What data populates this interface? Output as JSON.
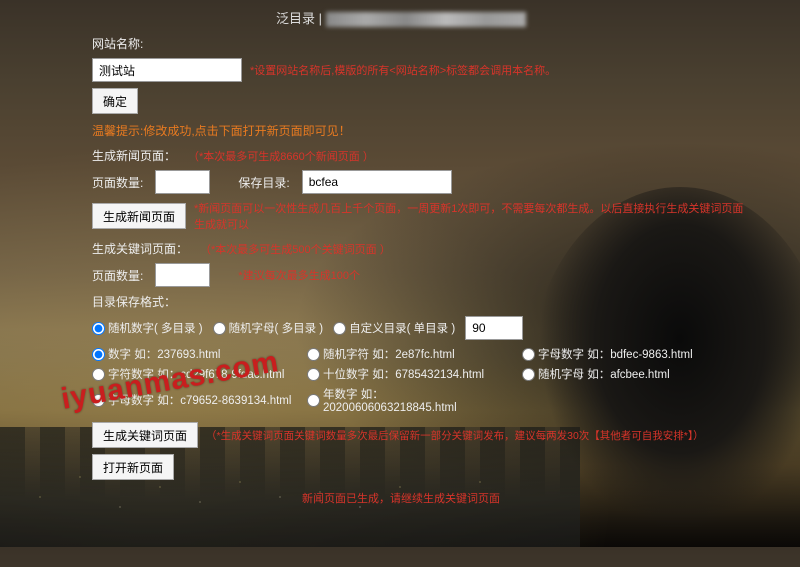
{
  "title_prefix": "泛目录 |",
  "watermark": "iyuanmas.com",
  "site": {
    "name_label": "网站名称:",
    "name_value": "测试站",
    "name_hint": "*设置网站名称后,模版的所有<网站名称>标签都会调用本名称。",
    "confirm_btn": "确定"
  },
  "tip_line": "温馨提示:修改成功,点击下面打开新页面即可见！",
  "news": {
    "gen_label": "生成新闻页面：",
    "gen_hint": "（*本次最多可生成8660个新闻页面 ）",
    "count_label": "页面数量:",
    "count_value": "",
    "save_dir_label": "保存目录:",
    "save_dir_value": "bcfea",
    "gen_btn": "生成新闻页面",
    "gen_note": "*新闻页面可以一次性生成几百上千个页面，一周更新1次即可，不需要每次都生成。以后直接执行生成关键词页面生成就可以"
  },
  "keyword": {
    "gen_label": "生成关键词页面：",
    "gen_hint": "（*本次最多可生成500个关键词页面 ）",
    "count_label": "页面数量:",
    "count_value": "",
    "count_hint": "*建议每次最多生成100个",
    "dir_format_label": "目录保存格式：",
    "dir_opts": {
      "opt1": "随机数字( 多目录 )",
      "opt2": "随机字母( 多目录 )",
      "opt3": "自定义目录( 单目录 )",
      "custom_value": "90"
    },
    "fmt_opts": {
      "r1c1": "数字 如：237693.html",
      "r1c2": "随机字符 如：2e87fc.html",
      "r1c3": "字母数字 如：bdfec-9863.html",
      "r2c1": "字符数字 如：cd29f678-9fdac.html",
      "r2c2": "十位数字 如：6785432134.html",
      "r2c3": "随机字母 如：afcbee.html",
      "r3c1": "字母数字 如：c79652-8639134.html",
      "r3c2": "年数字 如：20200606063218845.html"
    },
    "gen_btn": "生成关键词页面",
    "gen_note_left": "（*生成关键词页面关键词数量多次最后保留新一部分关键词发布，建议每两发30次【其他者可自我安排*】）",
    "open_btn": "打开新页面"
  },
  "footer": "新闻页面已生成，请继续生成关键词页面"
}
